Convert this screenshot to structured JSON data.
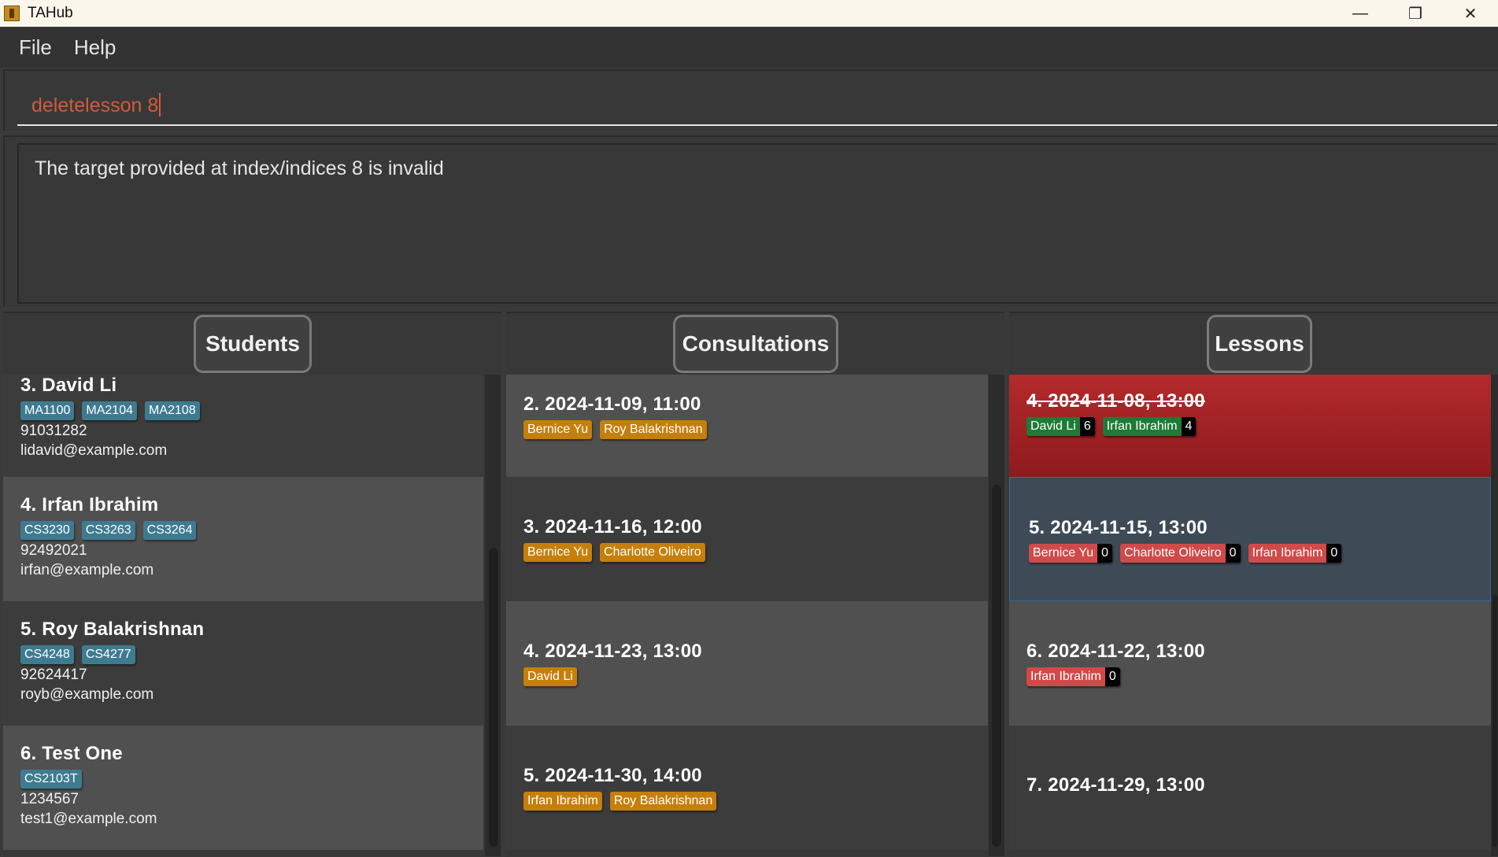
{
  "window": {
    "title": "TAHub",
    "controls": {
      "minimize": "—",
      "maximize": "❐",
      "close": "✕"
    }
  },
  "menu": {
    "items": [
      "File",
      "Help"
    ]
  },
  "command": {
    "value": "deletelesson 8"
  },
  "result": {
    "message": "The target provided at index/indices 8 is invalid"
  },
  "panels": {
    "students": {
      "title": "Students",
      "items": [
        {
          "title": "3. David Li",
          "tags": [
            "MA1100",
            "MA2104",
            "MA2108"
          ],
          "phone": "91031282",
          "email": "lidavid@example.com"
        },
        {
          "title": "4. Irfan Ibrahim",
          "tags": [
            "CS3230",
            "CS3263",
            "CS3264"
          ],
          "phone": "92492021",
          "email": "irfan@example.com"
        },
        {
          "title": "5. Roy Balakrishnan",
          "tags": [
            "CS4248",
            "CS4277"
          ],
          "phone": "92624417",
          "email": "royb@example.com"
        },
        {
          "title": "6. Test One",
          "tags": [
            "CS2103T"
          ],
          "phone": "1234567",
          "email": "test1@example.com"
        }
      ]
    },
    "consultations": {
      "title": "Consultations",
      "items": [
        {
          "title": "2. 2024-11-09, 11:00",
          "students": [
            "Bernice Yu",
            "Roy Balakrishnan"
          ]
        },
        {
          "title": "3. 2024-11-16, 12:00",
          "students": [
            "Bernice Yu",
            "Charlotte Oliveiro"
          ]
        },
        {
          "title": "4. 2024-11-23, 13:00",
          "students": [
            "David Li"
          ]
        },
        {
          "title": "5. 2024-11-30, 14:00",
          "students": [
            "Irfan Ibrahim",
            "Roy Balakrishnan"
          ]
        }
      ]
    },
    "lessons": {
      "title": "Lessons",
      "items": [
        {
          "title": "4. 2024-11-08, 13:00",
          "state": "past",
          "students": [
            {
              "name": "David Li",
              "count": "6",
              "color": "green"
            },
            {
              "name": "Irfan Ibrahim",
              "count": "4",
              "color": "green"
            }
          ]
        },
        {
          "title": "5. 2024-11-15, 13:00",
          "state": "selected",
          "students": [
            {
              "name": "Bernice Yu",
              "count": "0",
              "color": "red"
            },
            {
              "name": "Charlotte Oliveiro",
              "count": "0",
              "color": "red"
            },
            {
              "name": "Irfan Ibrahim",
              "count": "0",
              "color": "red"
            }
          ]
        },
        {
          "title": "6. 2024-11-22, 13:00",
          "state": "normal",
          "students": [
            {
              "name": "Irfan Ibrahim",
              "count": "0",
              "color": "red"
            }
          ]
        },
        {
          "title": "7. 2024-11-29, 13:00",
          "state": "normal",
          "students": []
        }
      ]
    }
  },
  "colors": {
    "command_text": "#d35a3a",
    "tag_blue": "#3e7b91",
    "tag_orange": "#c67f0b",
    "tag_green": "#1f7a36",
    "tag_red": "#d04a4a",
    "past_lesson": "#a8262a",
    "selected_lesson": "#3f4a57"
  }
}
